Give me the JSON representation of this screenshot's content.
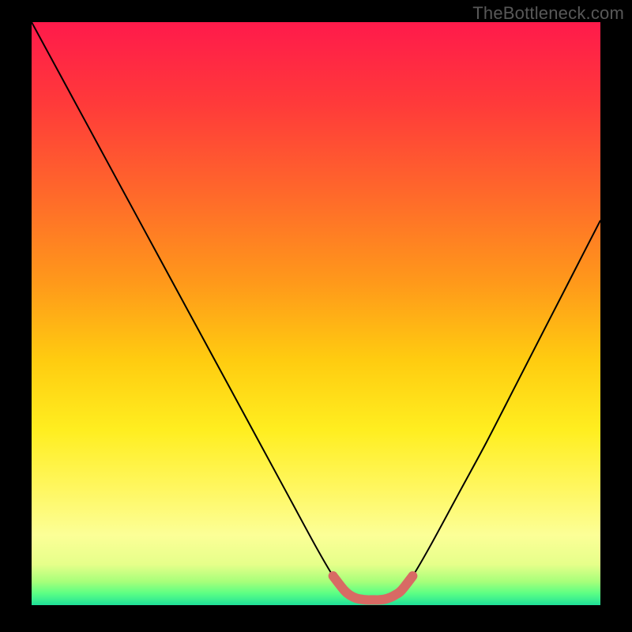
{
  "watermark": "TheBottleneck.com",
  "chart_data": {
    "type": "line",
    "title": "",
    "xlabel": "",
    "ylabel": "",
    "x_range": [
      0,
      100
    ],
    "y_range": [
      0,
      100
    ],
    "series": [
      {
        "name": "curve",
        "x": [
          0,
          5,
          10,
          15,
          20,
          25,
          30,
          35,
          40,
          45,
          50,
          53,
          55,
          58,
          62,
          65,
          67,
          70,
          75,
          80,
          85,
          90,
          95,
          100
        ],
        "y": [
          100,
          91,
          82,
          73,
          64,
          55,
          46,
          37,
          28,
          19,
          10,
          5,
          2.5,
          1,
          1,
          2.5,
          5,
          10,
          19,
          28,
          37.5,
          47,
          56.5,
          66
        ]
      },
      {
        "name": "highlight",
        "x": [
          53,
          55,
          56,
          57,
          58,
          59,
          60,
          61,
          62,
          63,
          64,
          65,
          67
        ],
        "y": [
          5,
          2.5,
          1.7,
          1.2,
          1,
          0.9,
          0.9,
          0.9,
          1,
          1.3,
          1.8,
          2.5,
          5
        ]
      }
    ],
    "gradient_stops": [
      {
        "pct": 0,
        "color": "#ff1a4b"
      },
      {
        "pct": 14,
        "color": "#ff3a3a"
      },
      {
        "pct": 30,
        "color": "#ff6a2a"
      },
      {
        "pct": 45,
        "color": "#ff9a1a"
      },
      {
        "pct": 58,
        "color": "#ffcc10"
      },
      {
        "pct": 70,
        "color": "#ffee20"
      },
      {
        "pct": 80,
        "color": "#fff760"
      },
      {
        "pct": 88,
        "color": "#fcff97"
      },
      {
        "pct": 93,
        "color": "#e6ff8a"
      },
      {
        "pct": 96,
        "color": "#a6ff7a"
      },
      {
        "pct": 98,
        "color": "#5bff84"
      },
      {
        "pct": 100,
        "color": "#1fe099"
      }
    ],
    "curve_color": "#000000",
    "highlight_color": "#d86a64",
    "highlight_stroke_width": 12
  }
}
